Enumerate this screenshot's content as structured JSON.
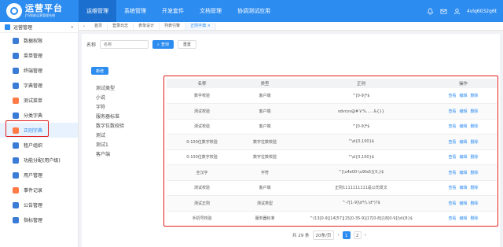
{
  "app": {
    "title": "运营平台",
    "subtitle": "JYS智能运营管理系统"
  },
  "topnav": [
    {
      "label": "运维管理",
      "active": true
    },
    {
      "label": "系统管理"
    },
    {
      "label": "开发套件"
    },
    {
      "label": "文档管理"
    },
    {
      "label": "协调测试应用"
    }
  ],
  "user": {
    "name": "4vlq6032q6t"
  },
  "sidebar": {
    "header": "运营管理",
    "items": [
      {
        "label": "数据权限",
        "color": "#3a7bd5"
      },
      {
        "label": "菜单管理",
        "color": "#3a7bd5"
      },
      {
        "label": "终端管理",
        "color": "#3a7bd5"
      },
      {
        "label": "字典管理",
        "color": "#3a7bd5"
      },
      {
        "label": "测试菜单",
        "color": "#ff7a45"
      },
      {
        "label": "分类字典",
        "color": "#3a7bd5"
      },
      {
        "label": "正则字典",
        "color": "#ff7a45",
        "active": true
      },
      {
        "label": "租户组织",
        "color": "#3a7bd5"
      },
      {
        "label": "功能分配(用户级)",
        "color": "#3a7bd5"
      },
      {
        "label": "用户管理",
        "color": "#3a7bd5"
      },
      {
        "label": "事件记录",
        "color": "#ff7a45"
      },
      {
        "label": "公告管理",
        "color": "#3a7bd5"
      },
      {
        "label": "指标管理",
        "color": "#3a7bd5"
      }
    ]
  },
  "tabs": [
    {
      "label": "首页"
    },
    {
      "label": "登录日志"
    },
    {
      "label": "表单设计"
    },
    {
      "label": "列表引擎"
    },
    {
      "label": "正则字典 ×",
      "active": true
    }
  ],
  "search": {
    "label": "名称",
    "placeholder": "名称",
    "search_label": "查询",
    "reset_label": "重置"
  },
  "add_label": "新增",
  "type_list": [
    "测试类型",
    "小说",
    "字符",
    "服务器标准",
    "数字位数校验",
    "测试",
    "测试1",
    "客户端"
  ],
  "table": {
    "columns": [
      "名称",
      "类型",
      "正则",
      "操作"
    ],
    "rows": [
      {
        "name": "数字校验",
        "type": "客户端",
        "regex": "^[0-9]*$"
      },
      {
        "name": "测试校验",
        "type": "客户端",
        "regex": "sdvcsv@#￥%......&{}}"
      },
      {
        "name": "测试校验",
        "type": "客户端",
        "regex": "^[0-9]*$"
      },
      {
        "name": "0-100位数字校验",
        "type": "数字位数校验",
        "regex": "^\\d{0,100}$"
      },
      {
        "name": "0-100位数字校验",
        "type": "数字位数校验",
        "regex": "^\\d{0,100}$"
      },
      {
        "name": "全汉字",
        "type": "字符",
        "regex": "^[\\u4e00-\\u9fa5]{0,}$"
      },
      {
        "name": "测试校验",
        "type": "客户端",
        "regex": "正则1111111111是公司发文"
      },
      {
        "name": "测试正则",
        "type": "测试类型",
        "regex": "^-?[1-9]\\d*(\\.\\d*)?$"
      },
      {
        "name": "手机号校验",
        "type": "服务器标准",
        "regex": "^(13[0-9]|14[57]|15[0-35-9]|17[0-8]|18[0-9])\\d{8}$"
      }
    ],
    "actions": [
      "查看",
      "编辑",
      "删除"
    ]
  },
  "pager": {
    "total": "共 29 条",
    "size": "20条/页",
    "pages": [
      "1",
      "2"
    ]
  }
}
